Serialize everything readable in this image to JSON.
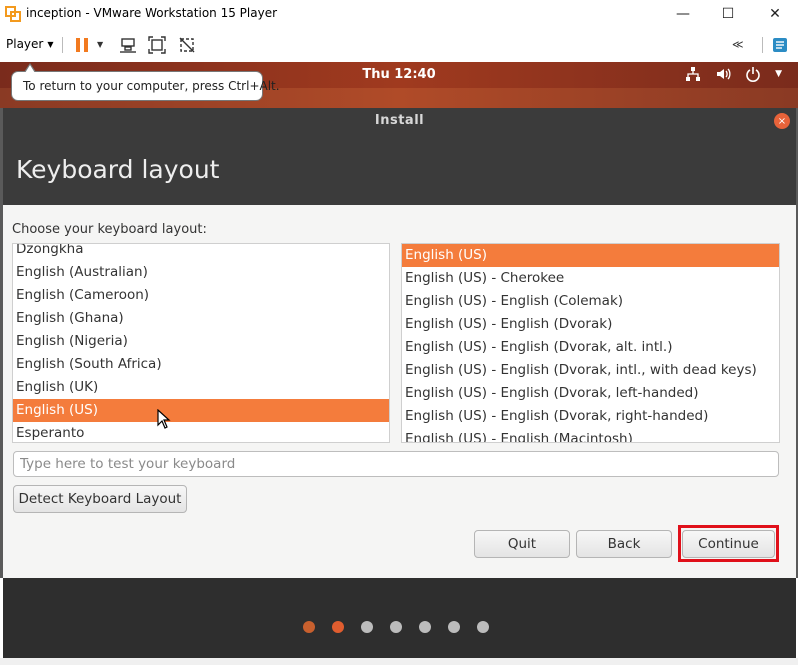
{
  "window": {
    "title": "inception - VMware Workstation 15 Player",
    "minimize": "—",
    "maximize": "☐",
    "close": "✕"
  },
  "toolbar": {
    "player_label": "Player",
    "player_caret": "▼",
    "pause_caret": "▼",
    "rewind": "≪"
  },
  "tooltip": {
    "text": "To return to your computer, press Ctrl+Alt."
  },
  "ubuntu_panel": {
    "clock": "Thu 12:40",
    "network_icon": "⊹",
    "volume_icon": "🔊",
    "power_icon": "⏻",
    "menu_caret": "▼"
  },
  "installer": {
    "window_title": "Install",
    "close": "×",
    "page_title": "Keyboard layout",
    "choose_label": "Choose your keyboard layout:",
    "layouts": [
      {
        "label": "Dzongkha",
        "selected": false
      },
      {
        "label": "English (Australian)",
        "selected": false
      },
      {
        "label": "English (Cameroon)",
        "selected": false
      },
      {
        "label": "English (Ghana)",
        "selected": false
      },
      {
        "label": "English (Nigeria)",
        "selected": false
      },
      {
        "label": "English (South Africa)",
        "selected": false
      },
      {
        "label": "English (UK)",
        "selected": false
      },
      {
        "label": "English (US)",
        "selected": true
      },
      {
        "label": "Esperanto",
        "selected": false
      }
    ],
    "variants": [
      {
        "label": "English (US)",
        "selected": true
      },
      {
        "label": "English (US) - Cherokee",
        "selected": false
      },
      {
        "label": "English (US) - English (Colemak)",
        "selected": false
      },
      {
        "label": "English (US) - English (Dvorak)",
        "selected": false
      },
      {
        "label": "English (US) - English (Dvorak, alt. intl.)",
        "selected": false
      },
      {
        "label": "English (US) - English (Dvorak, intl., with dead keys)",
        "selected": false
      },
      {
        "label": "English (US) - English (Dvorak, left-handed)",
        "selected": false
      },
      {
        "label": "English (US) - English (Dvorak, right-handed)",
        "selected": false
      },
      {
        "label": "English (US) - English (Macintosh)",
        "selected": false
      }
    ],
    "test_placeholder": "Type here to test your keyboard",
    "detect_label": "Detect Keyboard Layout",
    "quit_label": "Quit",
    "back_label": "Back",
    "continue_label": "Continue",
    "progress": {
      "total_steps": 7,
      "current_step": 2
    }
  },
  "colors": {
    "accent": "#f47c3c",
    "highlight": "#e0101a"
  }
}
